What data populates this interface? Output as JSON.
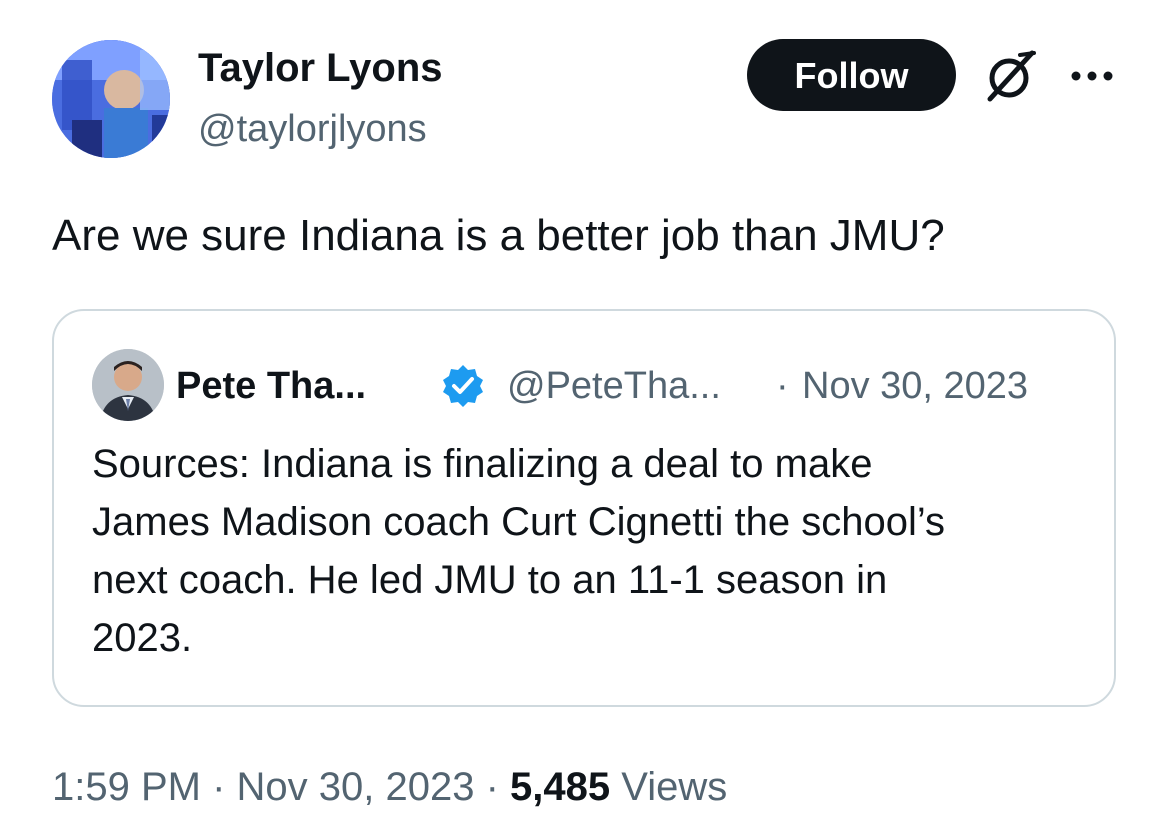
{
  "author": {
    "name": "Taylor Lyons",
    "handle": "@taylorjlyons"
  },
  "actions": {
    "follow_label": "Follow",
    "grok_icon": "grok-icon",
    "more_icon": "more-options-icon"
  },
  "tweet": {
    "text": "Are we sure Indiana is a better job than JMU?"
  },
  "quote": {
    "name": "Pete Tha...",
    "verified_icon": "verified-badge-icon",
    "handle": "@PeteTha...",
    "separator": "·",
    "date": "Nov 30, 2023",
    "lines": [
      "Sources: Indiana is finalizing a deal to make",
      "James Madison coach Curt Cignetti the school’s",
      "next coach. He led JMU to an 11-1 season in",
      "2023."
    ]
  },
  "meta": {
    "time": "1:59 PM",
    "sep1": " · ",
    "date": "Nov 30, 2023",
    "sep2": " · ",
    "views_count": "5,485",
    "views_label": " Views"
  },
  "colors": {
    "text_primary": "#0f1419",
    "text_secondary": "#536471",
    "border": "#cfd9de",
    "verified": "#1d9bf0",
    "follow_bg": "#0f1419"
  }
}
